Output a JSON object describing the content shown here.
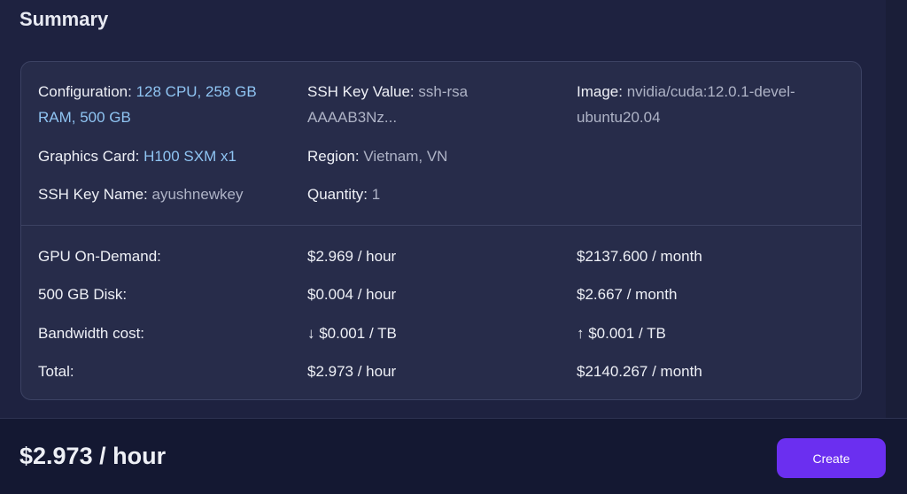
{
  "summary": {
    "title": "Summary",
    "configuration": {
      "label": "Configuration:",
      "value_line1": "128 CPU, 258 GB",
      "value_line2": "RAM, 500 GB"
    },
    "ssh_key_value": {
      "label": "SSH Key Value:",
      "value_line1": "ssh-rsa",
      "value_line2": "AAAAB3Nz..."
    },
    "image": {
      "label": "Image:",
      "value_line1": "nvidia/cuda:12.0.1-devel-",
      "value_line2": "ubuntu20.04"
    },
    "graphics_card": {
      "label": "Graphics Card:",
      "value": "H100 SXM x1"
    },
    "region": {
      "label": "Region:",
      "value": "Vietnam, VN"
    },
    "ssh_key_name": {
      "label": "SSH Key Name:",
      "value": "ayushnewkey"
    },
    "quantity": {
      "label": "Quantity:",
      "value": "1"
    }
  },
  "pricing": {
    "rows": [
      {
        "label": "GPU On-Demand:",
        "hourly": "$2.969 / hour",
        "monthly": "$2137.600 / month"
      },
      {
        "label": "500 GB Disk:",
        "hourly": "$0.004 / hour",
        "monthly": "$2.667 / month"
      },
      {
        "label": "Bandwidth cost:",
        "hourly": "↓ $0.001 / TB",
        "monthly": "↑ $0.001 / TB"
      },
      {
        "label": "Total:",
        "hourly": "$2.973 / hour",
        "monthly": "$2140.267 / month"
      }
    ]
  },
  "footer": {
    "total_price": "$2.973 / hour",
    "create_label": "Create"
  },
  "colors": {
    "background": "#1e2240",
    "card": "#272c4a",
    "accent_text": "#8fc4f2",
    "button": "#6b2ff0",
    "footer": "#141832"
  }
}
